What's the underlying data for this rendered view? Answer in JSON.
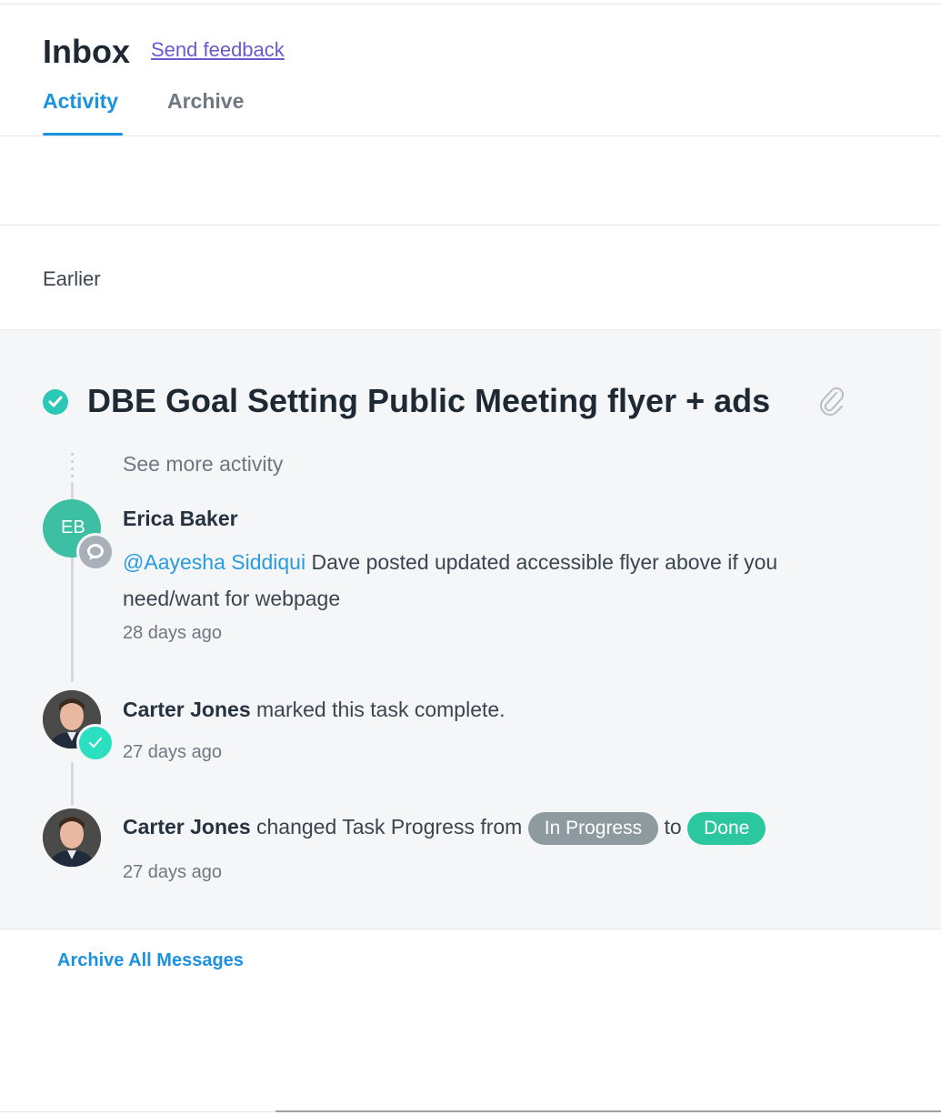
{
  "header": {
    "title": "Inbox",
    "feedback_link": "Send feedback",
    "tabs": [
      {
        "label": "Activity",
        "active": true
      },
      {
        "label": "Archive",
        "active": false
      }
    ]
  },
  "section": {
    "label": "Earlier"
  },
  "task": {
    "title": "DBE Goal Setting Public Meeting flyer + ads",
    "completed": true,
    "has_attachment": true,
    "see_more": "See more activity",
    "stories": [
      {
        "type": "comment",
        "author": "Erica Baker",
        "avatar_initials": "EB",
        "mention": "@Aayesha Siddiqui",
        "text": " Dave posted updated accessible flyer above if you need/want for webpage",
        "time": "28 days ago"
      },
      {
        "type": "completion",
        "author": "Carter Jones",
        "text": " marked this task complete.",
        "time": "27 days ago"
      },
      {
        "type": "field-change",
        "author": "Carter Jones",
        "text": " changed Task Progress from ",
        "from_value": "In Progress",
        "connector": " to ",
        "to_value": "Done",
        "time": "27 days ago"
      }
    ]
  },
  "footer": {
    "archive_all": "Archive All Messages"
  },
  "colors": {
    "accent": "#1b92e0",
    "complete_green": "#2bc8b6",
    "pill_in_progress": "#8d9aa0",
    "pill_done": "#2bc8a0"
  }
}
